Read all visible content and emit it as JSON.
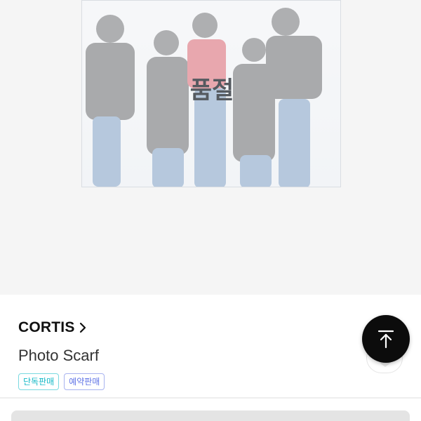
{
  "product": {
    "status_overlay": "품절",
    "brand": "CORTIS",
    "title": "Photo Scarf",
    "tags": [
      "단독판매",
      "예약판매"
    ]
  },
  "icons": {
    "brand_link": "chevron-right-icon",
    "wishlist": "heart-icon",
    "scroll_top": "arrow-up-to-top-icon"
  },
  "colors": {
    "tag_exclusive": "#15b9c7",
    "tag_preorder": "#5f73e6",
    "top_button": "#0c0c0c"
  }
}
